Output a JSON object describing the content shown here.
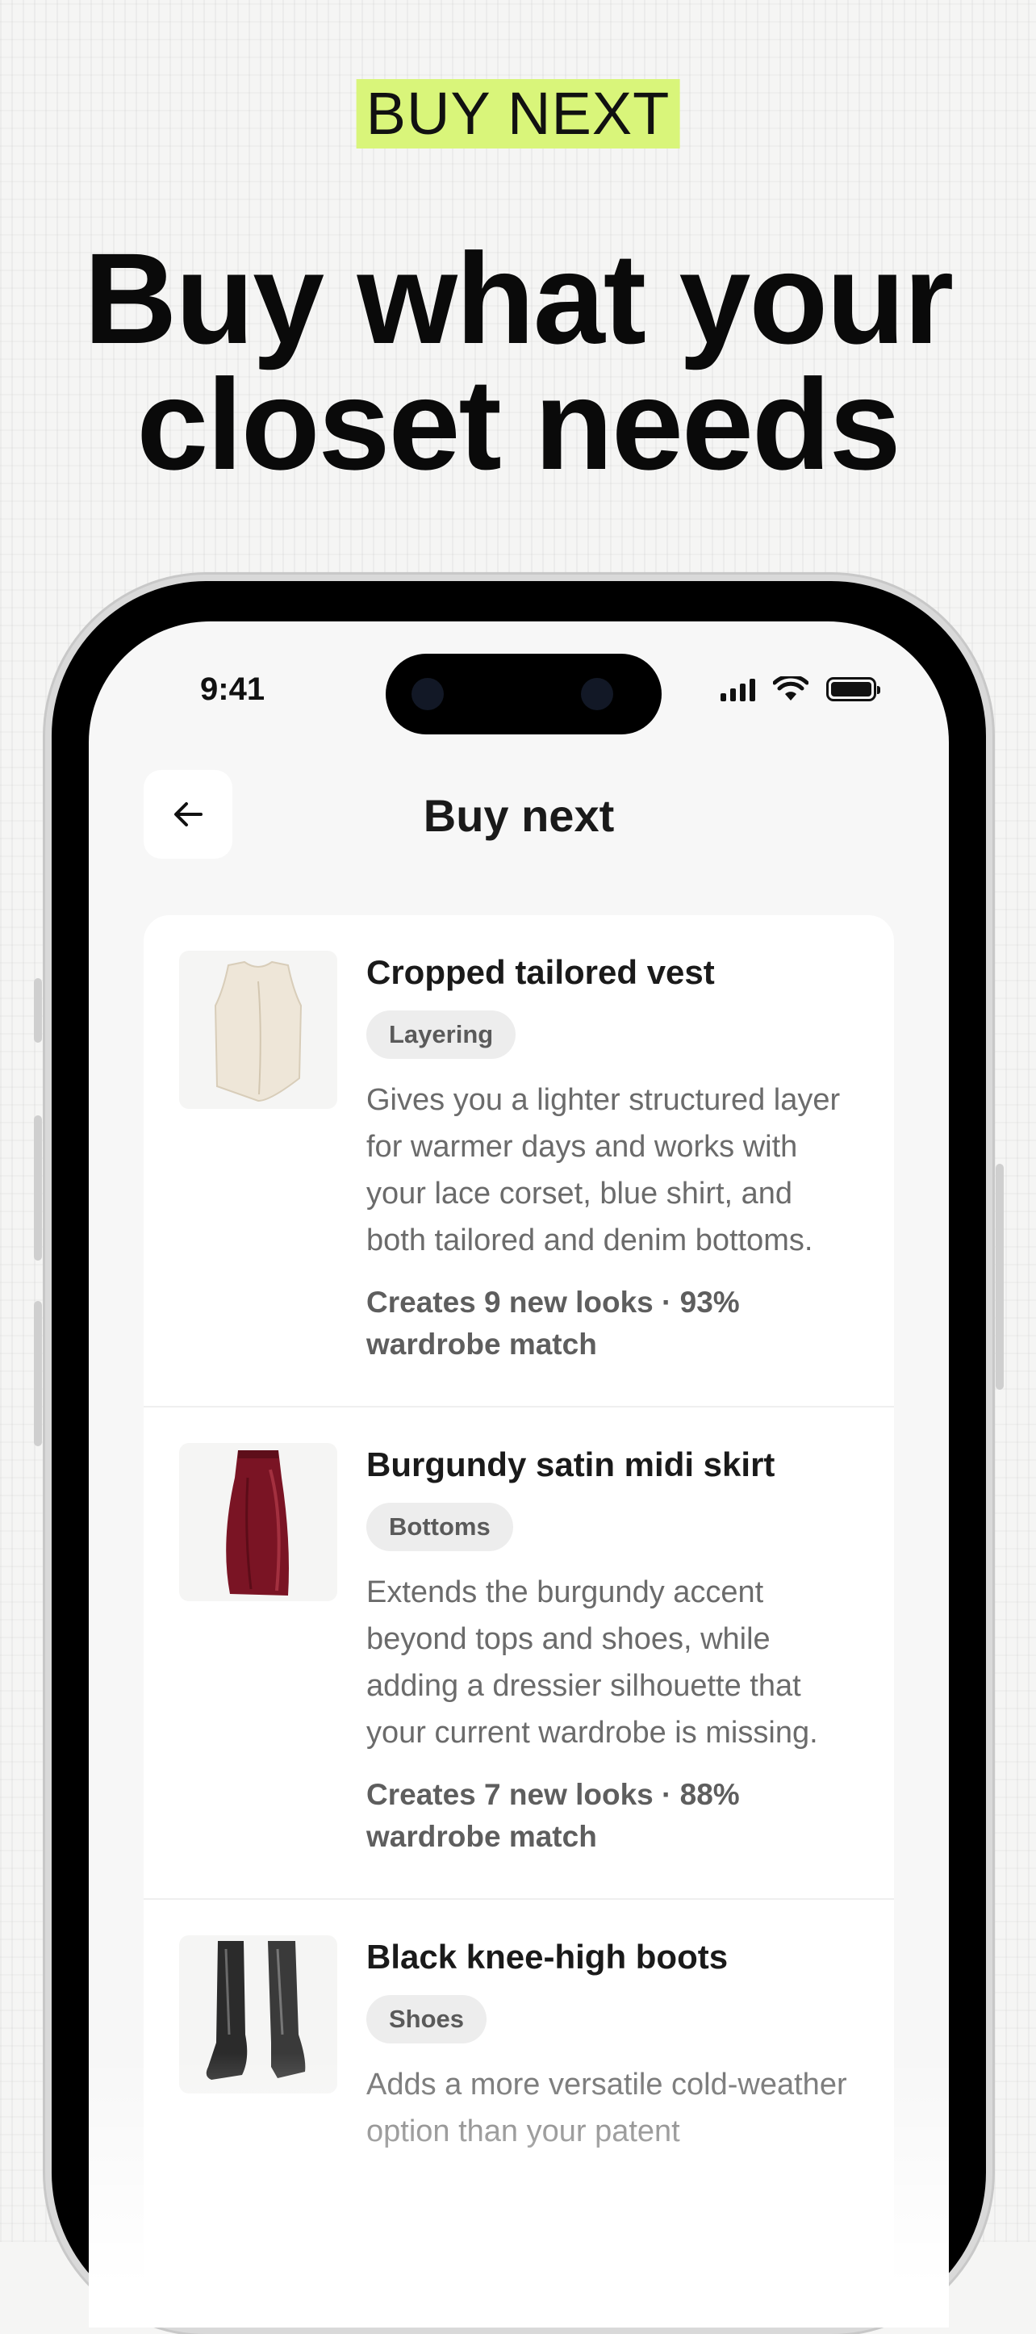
{
  "hero": {
    "eyebrow": "BUY NEXT",
    "headline_line1": "Buy what your",
    "headline_line2": "closet needs",
    "eyebrow_color": "#d9f57a"
  },
  "status_bar": {
    "time": "9:41",
    "icons": [
      "cellular-signal-icon",
      "wifi-icon",
      "battery-icon"
    ]
  },
  "nav": {
    "back_icon": "arrow-left-icon",
    "title": "Buy next"
  },
  "items": [
    {
      "title": "Cropped tailored vest",
      "tag": "Layering",
      "description": "Gives you a lighter structured layer for warmer days and works with your lace corset, blue shirt, and both tailored and denim bottoms.",
      "meta": "Creates 9 new looks · 93% wardrobe match",
      "image": "cropped-vest-image"
    },
    {
      "title": "Burgundy satin midi skirt",
      "tag": "Bottoms",
      "description": "Extends the burgundy accent beyond tops and shoes, while adding a dressier silhouette that your current wardrobe is missing.",
      "meta": "Creates 7 new looks · 88% wardrobe match",
      "image": "burgundy-skirt-image"
    },
    {
      "title": "Black knee-high boots",
      "tag": "Shoes",
      "description": "Adds a more versatile cold-weather option than your patent",
      "meta": "",
      "image": "black-boots-image"
    }
  ]
}
